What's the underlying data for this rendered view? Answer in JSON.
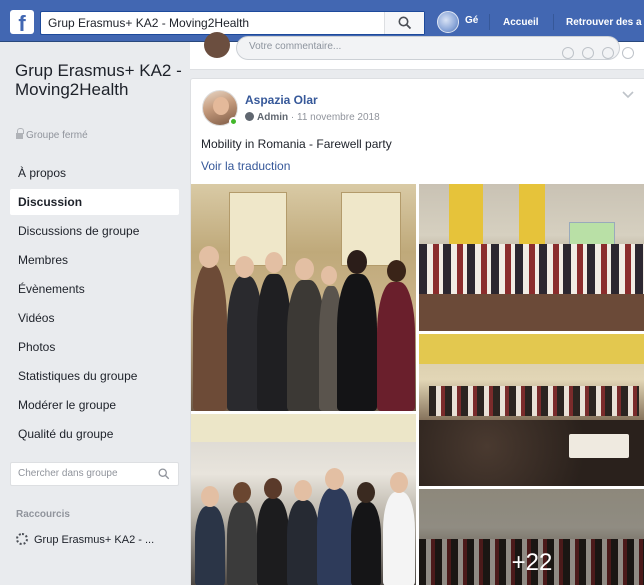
{
  "topbar": {
    "logo": "f",
    "search_value": "Grup Erasmus+ KA2 - Moving2Health",
    "profile_name": "Gé",
    "nav": [
      "Accueil",
      "Retrouver des a"
    ]
  },
  "sidebar": {
    "group_name": "Grup Erasmus+ KA2 - Moving2Health",
    "group_type": "Groupe fermé",
    "items": [
      {
        "label": "À propos"
      },
      {
        "label": "Discussion",
        "active": true
      },
      {
        "label": "Discussions de groupe"
      },
      {
        "label": "Membres"
      },
      {
        "label": "Évènements"
      },
      {
        "label": "Vidéos"
      },
      {
        "label": "Photos"
      },
      {
        "label": "Statistiques du groupe"
      },
      {
        "label": "Modérer le groupe"
      },
      {
        "label": "Qualité du groupe"
      }
    ],
    "search_placeholder": "Chercher dans groupe",
    "shortcuts_title": "Raccourcis",
    "shortcut": "Grup Erasmus+ KA2 - ..."
  },
  "composer": {
    "placeholder": "Votre commentaire..."
  },
  "post": {
    "author": "Aspazia Olar",
    "role": "Admin",
    "date": "11 novembre 2018",
    "text": "Mobility in Romania - Farewell party",
    "translate": "Voir la traduction",
    "more_photos": "+22"
  },
  "colors": {
    "brand": "#4267b2",
    "link": "#365899",
    "background": "#e9ebee"
  }
}
